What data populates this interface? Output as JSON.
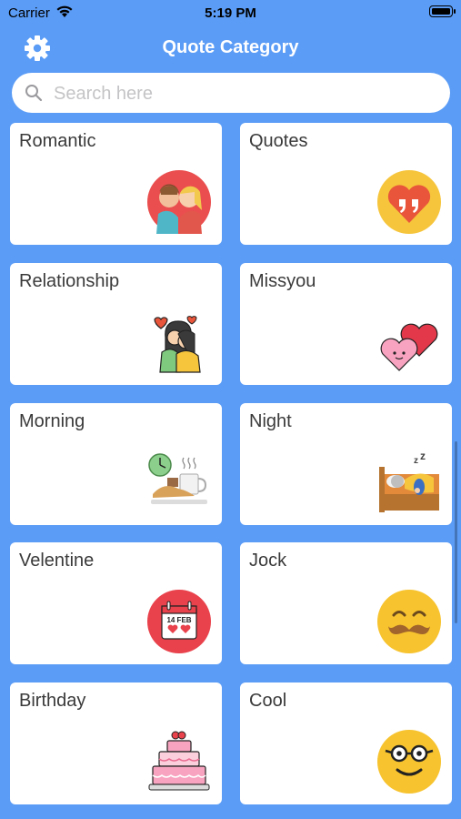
{
  "status": {
    "carrier": "Carrier",
    "time": "5:19 PM"
  },
  "nav": {
    "title": "Quote Category"
  },
  "search": {
    "placeholder": "Search here"
  },
  "categories": [
    {
      "label": "Romantic",
      "icon": "couple-kiss-icon"
    },
    {
      "label": "Quotes",
      "icon": "quote-heart-icon"
    },
    {
      "label": "Relationship",
      "icon": "hugging-couple-icon"
    },
    {
      "label": "Missyou",
      "icon": "two-hearts-icon"
    },
    {
      "label": "Morning",
      "icon": "coffee-croissant-icon"
    },
    {
      "label": "Night",
      "icon": "sleeping-bed-icon"
    },
    {
      "label": "Velentine",
      "icon": "valentine-calendar-icon"
    },
    {
      "label": "Jock",
      "icon": "mustache-smiley-icon"
    },
    {
      "label": "Birthday",
      "icon": "birthday-cake-icon"
    },
    {
      "label": "Cool",
      "icon": "glasses-smiley-icon"
    }
  ],
  "calendar_text": "14 FEB",
  "colors": {
    "background": "#5b9cf6",
    "card": "#ffffff",
    "title": "#ffffff"
  }
}
